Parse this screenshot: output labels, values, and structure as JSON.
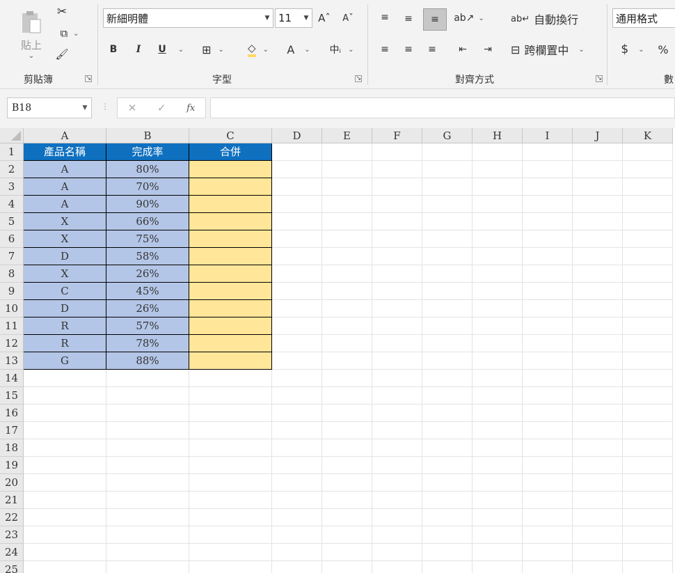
{
  "ribbon": {
    "clipboard": {
      "paste_label": "貼上",
      "group_label": "剪貼簿"
    },
    "font": {
      "font_name": "新細明體",
      "font_size": "11",
      "group_label": "字型",
      "bold": "B",
      "italic": "I",
      "underline": "U",
      "font_color": "A"
    },
    "alignment": {
      "wrap_label": "自動換行",
      "merge_label": "跨欄置中",
      "group_label": "對齊方式"
    },
    "number": {
      "format": "通用格式",
      "currency": "$",
      "percent": "%",
      "group_label": "數"
    }
  },
  "formula_bar": {
    "name_box": "B18",
    "formula": ""
  },
  "sheet": {
    "columns": [
      "A",
      "B",
      "C",
      "D",
      "E",
      "F",
      "G",
      "H",
      "I",
      "J",
      "K"
    ],
    "row_numbers": [
      "1",
      "2",
      "3",
      "4",
      "5",
      "6",
      "7",
      "8",
      "9",
      "10",
      "11",
      "12",
      "13",
      "14",
      "15",
      "16",
      "17",
      "18",
      "19",
      "20",
      "21",
      "22",
      "23",
      "24",
      "25"
    ],
    "headers": [
      "產品名稱",
      "完成率",
      "合併"
    ],
    "rows": [
      [
        "A",
        "80%",
        ""
      ],
      [
        "A",
        "70%",
        ""
      ],
      [
        "A",
        "90%",
        ""
      ],
      [
        "X",
        "66%",
        ""
      ],
      [
        "X",
        "75%",
        ""
      ],
      [
        "D",
        "58%",
        ""
      ],
      [
        "X",
        "26%",
        ""
      ],
      [
        "C",
        "45%",
        ""
      ],
      [
        "D",
        "26%",
        ""
      ],
      [
        "R",
        "57%",
        ""
      ],
      [
        "R",
        "78%",
        ""
      ],
      [
        "G",
        "88%",
        ""
      ]
    ]
  },
  "colors": {
    "header_fill": "#0f70c0",
    "data_fill": "#b4c6e7",
    "merge_fill": "#ffe699"
  }
}
